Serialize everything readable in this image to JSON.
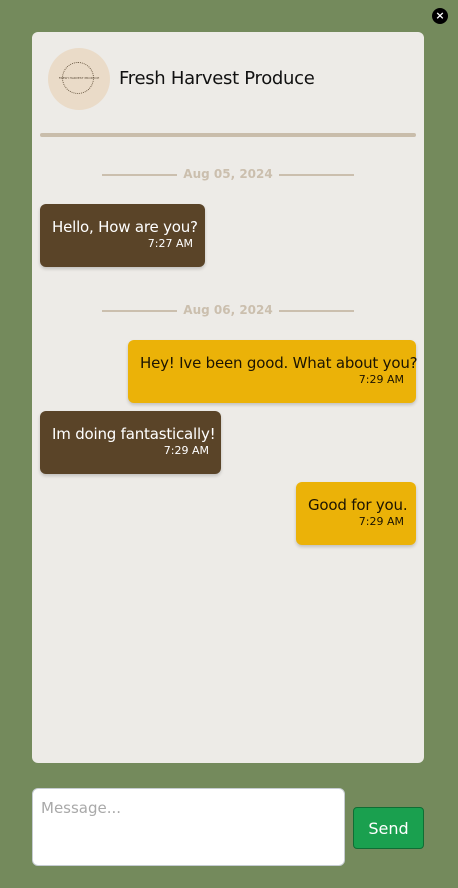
{
  "window": {
    "close_glyph": "×"
  },
  "header": {
    "avatar_text": "FRESH HARVEST PRODUCE",
    "shop_name": "Fresh Harvest Produce"
  },
  "conversation": {
    "date_separators": [
      {
        "label": "Aug 05, 2024"
      },
      {
        "label": "Aug 06, 2024"
      }
    ],
    "messages": [
      {
        "direction": "incoming",
        "text": "Hello, How are you?",
        "time": "7:27 AM"
      },
      {
        "direction": "outgoing",
        "text": "Hey! Ive been good. What about you?",
        "time": "7:29 AM"
      },
      {
        "direction": "incoming",
        "text": "Im doing fantastically!",
        "time": "7:29 AM"
      },
      {
        "direction": "outgoing",
        "text": "Good for you.",
        "time": "7:29 AM"
      }
    ]
  },
  "composer": {
    "placeholder": "Message...",
    "value": "",
    "send_label": "Send"
  },
  "colors": {
    "page_background": "#748a5c",
    "card_background": "#edebe7",
    "incoming_bubble": "#5a4428",
    "outgoing_bubble": "#ebb208",
    "send_button": "#1aa04f",
    "divider": "#c9bdab"
  },
  "icons": {
    "close": "close-icon"
  }
}
